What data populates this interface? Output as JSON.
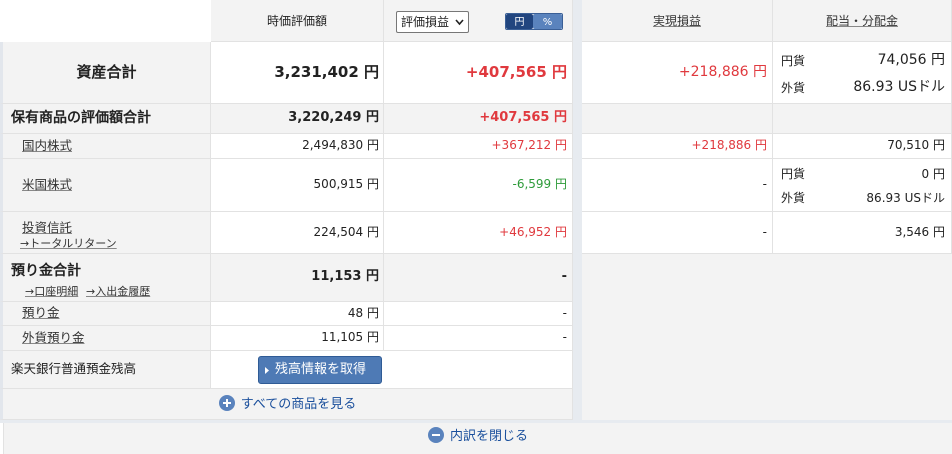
{
  "header": {
    "market_value": "時価評価額",
    "pl_select": "評価損益",
    "toggle_yen": "円",
    "toggle_pct": "%",
    "realized_pl": "実現損益",
    "dividends": "配当・分配金"
  },
  "total": {
    "label": "資産合計",
    "value": "3,231,402 円",
    "pl": "+407,565 円",
    "realized": "+218,886 円",
    "div_yen_label": "円貨",
    "div_yen": "74,056 円",
    "div_fx_label": "外貨",
    "div_fx": "86.93 USドル"
  },
  "holdings": {
    "label": "保有商品の評価額合計",
    "value": "3,220,249 円",
    "pl": "+407,565 円",
    "rows": [
      {
        "label": "国内株式",
        "value": "2,494,830 円",
        "pl": "+367,212 円",
        "realized": "+218,886 円",
        "div": "70,510 円"
      },
      {
        "label": "米国株式",
        "value": "500,915 円",
        "pl": "-6,599 円",
        "realized": "-",
        "div_yen_label": "円貨",
        "div_yen": "0 円",
        "div_fx_label": "外貨",
        "div_fx": "86.93 USドル"
      },
      {
        "label": "投資信託",
        "sub": "→トータルリターン",
        "value": "224,504 円",
        "pl": "+46,952 円",
        "realized": "-",
        "div": "3,546 円"
      }
    ]
  },
  "deposits": {
    "label": "預り金合計",
    "link1": "→口座明細",
    "link2": "→入出金履歴",
    "value": "11,153 円",
    "pl": "-",
    "rows": [
      {
        "label": "預り金",
        "value": "48 円",
        "pl": "-"
      },
      {
        "label": "外貨預り金",
        "value": "11,105 円",
        "pl": "-"
      }
    ]
  },
  "bank": {
    "label": "楽天銀行普通預金残高",
    "button": "残高情報を取得"
  },
  "footer": {
    "see_all": "すべての商品を見る",
    "close": "内訳を閉じる"
  },
  "colors": {
    "red": "#e0393e",
    "green": "#2e9b3a",
    "blue": "#4e7ab5",
    "link_blue": "#1a4f9c"
  }
}
